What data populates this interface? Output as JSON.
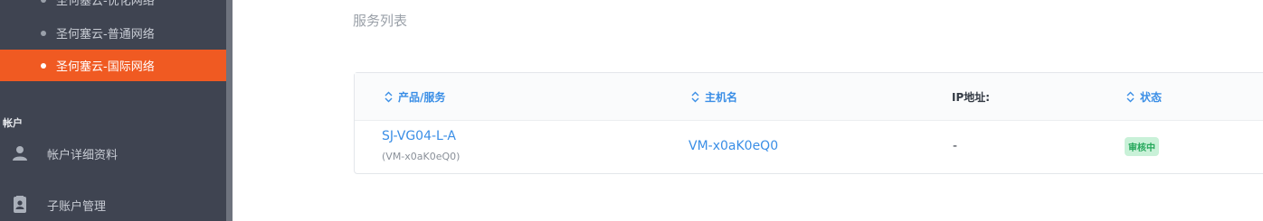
{
  "sidebar": {
    "sub_items": [
      {
        "label": "圣何塞云-优化网络",
        "active": false
      },
      {
        "label": "圣何塞云-普通网络",
        "active": false
      },
      {
        "label": "圣何塞云-国际网络",
        "active": true
      }
    ],
    "section_title": "帐户",
    "items": [
      {
        "label": "帐户详细资料",
        "icon": "user-icon"
      },
      {
        "label": "子账户管理",
        "icon": "contact-card-icon"
      }
    ]
  },
  "main": {
    "title": "服务列表",
    "table": {
      "columns": [
        {
          "label": "产品/服务",
          "sortable": true
        },
        {
          "label": "主机名",
          "sortable": true
        },
        {
          "label": "IP地址:",
          "sortable": false
        },
        {
          "label": "状态",
          "sortable": true
        }
      ],
      "rows": [
        {
          "product": "SJ-VG04-L-A",
          "product_sub": "(VM-x0aK0eQ0)",
          "hostname": "VM-x0aK0eQ0",
          "ip": "-",
          "status": "审核中"
        }
      ]
    }
  },
  "colors": {
    "sidebar_bg": "#3f4451",
    "active_bg": "#f05a22",
    "link": "#3a8ee6",
    "status_bg": "#c9f1d8",
    "status_text": "#25a85b"
  }
}
